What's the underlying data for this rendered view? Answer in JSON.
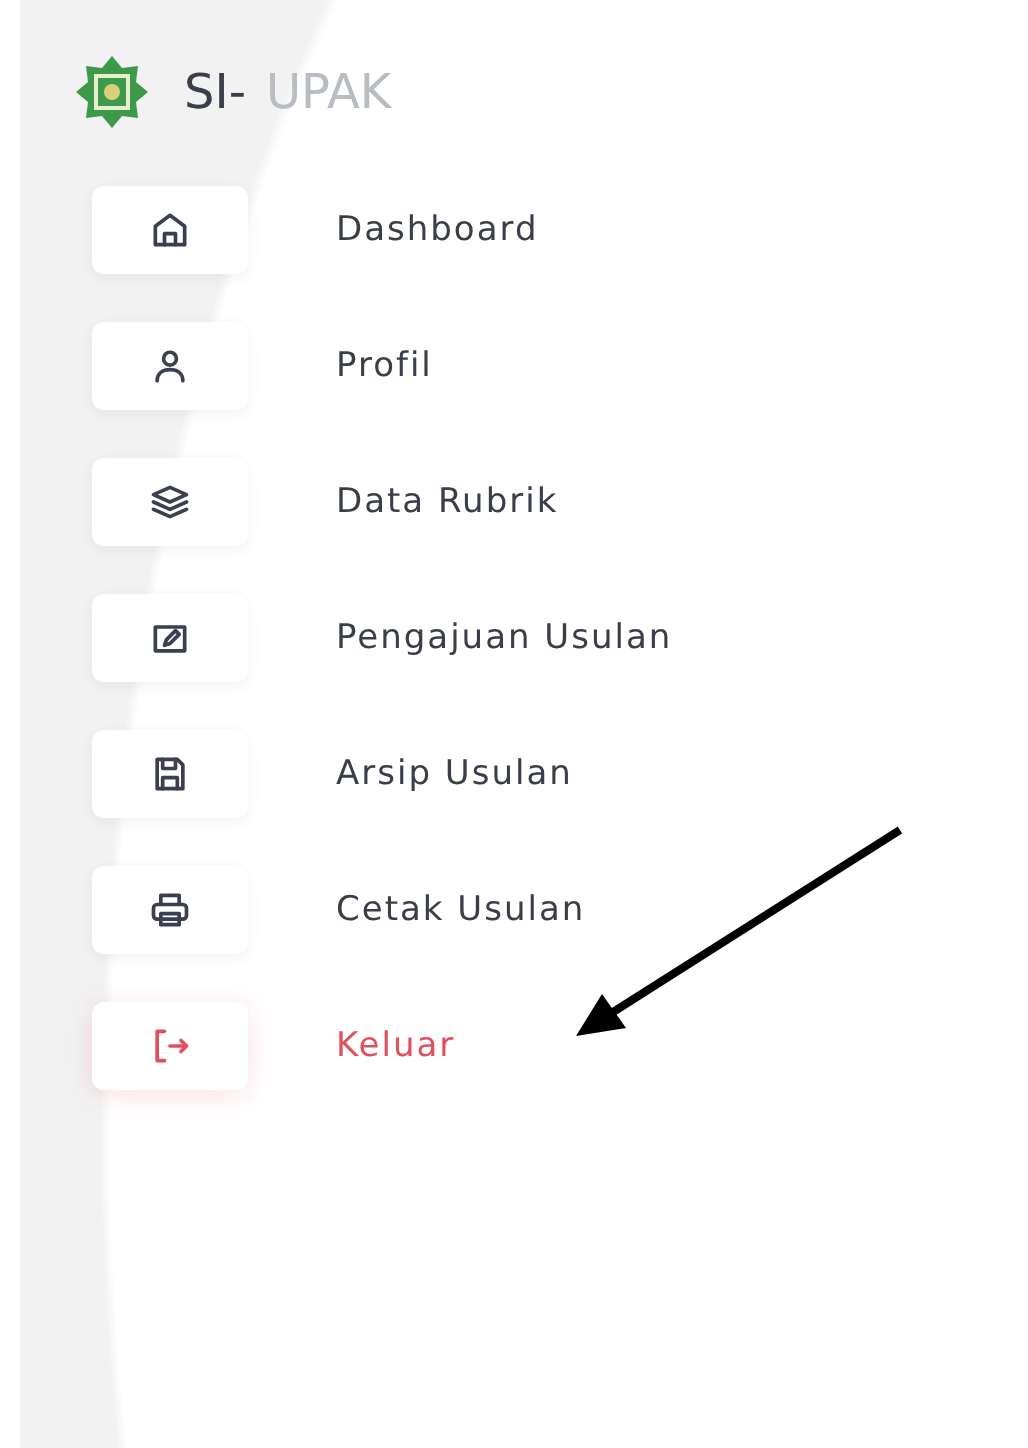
{
  "brand": {
    "prefix": "SI-",
    "name": "UPAK"
  },
  "menu": [
    {
      "label": "Dashboard",
      "kind": "nav"
    },
    {
      "label": "Profil",
      "kind": "nav"
    },
    {
      "label": "Data Rubrik",
      "kind": "nav"
    },
    {
      "label": "Pengajuan Usulan",
      "kind": "nav"
    },
    {
      "label": "Arsip Usulan",
      "kind": "nav"
    },
    {
      "label": "Cetak Usulan",
      "kind": "nav"
    },
    {
      "label": "Keluar",
      "kind": "logout"
    }
  ]
}
